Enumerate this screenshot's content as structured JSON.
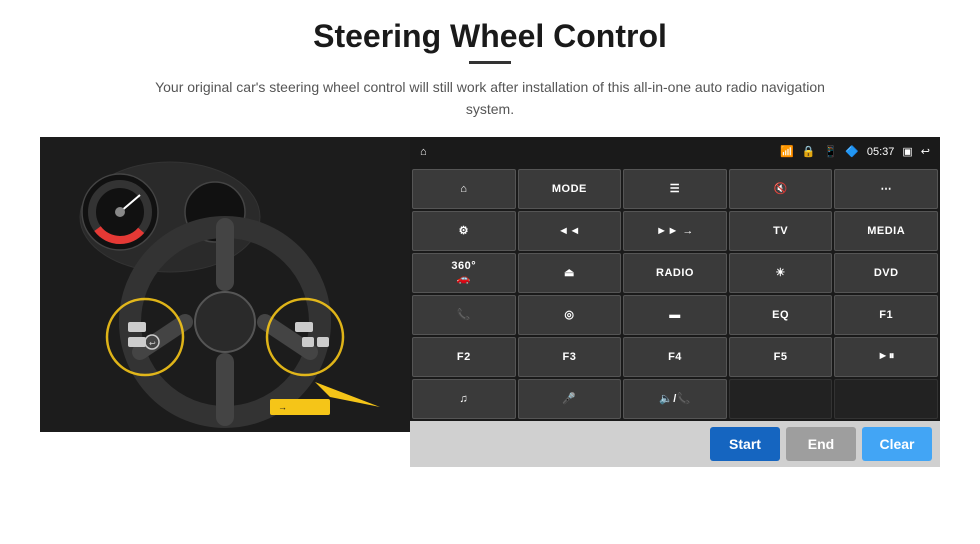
{
  "header": {
    "title": "Steering Wheel Control",
    "subtitle": "Your original car's steering wheel control will still work after installation of this all-in-one auto radio navigation system."
  },
  "status_bar": {
    "time": "05:37",
    "icons": [
      "wifi",
      "lock",
      "sim",
      "bluetooth",
      "screen",
      "back"
    ]
  },
  "control_grid": {
    "rows": [
      [
        {
          "label": "⌂",
          "type": "icon",
          "name": "home"
        },
        {
          "label": "MODE",
          "type": "text",
          "name": "mode"
        },
        {
          "label": "☰",
          "type": "icon",
          "name": "list"
        },
        {
          "label": "🔇",
          "type": "icon",
          "name": "mute"
        },
        {
          "label": "⋯",
          "type": "icon",
          "name": "apps"
        }
      ],
      [
        {
          "label": "⚙",
          "type": "icon",
          "name": "settings"
        },
        {
          "label": "◄◄",
          "type": "icon",
          "name": "prev"
        },
        {
          "label": "►►",
          "type": "icon",
          "name": "next"
        },
        {
          "label": "TV",
          "type": "text",
          "name": "tv"
        },
        {
          "label": "MEDIA",
          "type": "text",
          "name": "media"
        }
      ],
      [
        {
          "label": "360°",
          "type": "text",
          "name": "360cam"
        },
        {
          "label": "⏏",
          "type": "icon",
          "name": "eject"
        },
        {
          "label": "RADIO",
          "type": "text",
          "name": "radio"
        },
        {
          "label": "☀",
          "type": "icon",
          "name": "brightness"
        },
        {
          "label": "DVD",
          "type": "text",
          "name": "dvd"
        }
      ],
      [
        {
          "label": "📞",
          "type": "icon",
          "name": "phone"
        },
        {
          "label": "◎",
          "type": "icon",
          "name": "globe"
        },
        {
          "label": "▬",
          "type": "icon",
          "name": "rect"
        },
        {
          "label": "EQ",
          "type": "text",
          "name": "eq"
        },
        {
          "label": "F1",
          "type": "text",
          "name": "f1"
        }
      ],
      [
        {
          "label": "F2",
          "type": "text",
          "name": "f2"
        },
        {
          "label": "F3",
          "type": "text",
          "name": "f3"
        },
        {
          "label": "F4",
          "type": "text",
          "name": "f4"
        },
        {
          "label": "F5",
          "type": "text",
          "name": "f5"
        },
        {
          "label": "►⏸",
          "type": "icon",
          "name": "playpause"
        }
      ],
      [
        {
          "label": "♫",
          "type": "icon",
          "name": "music"
        },
        {
          "label": "🎤",
          "type": "icon",
          "name": "mic"
        },
        {
          "label": "🔈/📞",
          "type": "icon",
          "name": "vol-phone"
        },
        {
          "label": "",
          "type": "empty",
          "name": "empty1"
        },
        {
          "label": "",
          "type": "empty",
          "name": "empty2"
        }
      ]
    ]
  },
  "action_bar": {
    "start_label": "Start",
    "end_label": "End",
    "clear_label": "Clear"
  }
}
